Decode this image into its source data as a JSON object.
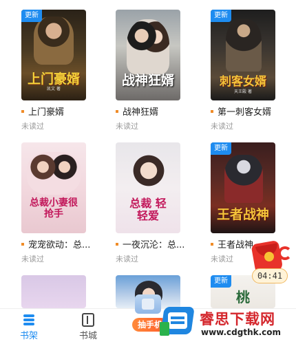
{
  "books": [
    {
      "title": "上门豪婿",
      "status": "未读过",
      "badge": "更新",
      "cover_title": "上门豪婿",
      "cover_author": "凯文 著",
      "cover_color": "#f4d23a"
    },
    {
      "title": "战神狂婿",
      "status": "未读过",
      "badge": "",
      "cover_title": "战神狂婿",
      "cover_author": "",
      "cover_color": "#ffffff"
    },
    {
      "title": "第一刺客女婿",
      "status": "未读过",
      "badge": "更新",
      "cover_title": "刺客女婿",
      "cover_author": "天王殿 著",
      "cover_color": "#f4c43a"
    },
    {
      "title": "宠宠欲动：总...",
      "status": "未读过",
      "badge": "",
      "cover_title": "总裁小妻很抢手",
      "cover_author": "",
      "cover_color": "#c2185b"
    },
    {
      "title": "一夜沉沦：总...",
      "status": "未读过",
      "badge": "",
      "cover_title": "总裁 轻轻爱",
      "cover_author": "",
      "cover_color": "#c2185b"
    },
    {
      "title": "王者战神",
      "status": "未读过",
      "badge": "更新",
      "cover_title": "王者战神",
      "cover_author": "",
      "cover_color": "#f4c43a"
    },
    {
      "title": "",
      "status": "",
      "badge": "",
      "cover_title": "",
      "cover_author": "",
      "cover_color": ""
    },
    {
      "title": "",
      "status": "",
      "badge": "",
      "cover_title": "",
      "cover_author": "",
      "cover_color": ""
    },
    {
      "title": "",
      "status": "",
      "badge": "更新",
      "cover_title": "桃",
      "cover_author": "",
      "cover_color": "#2a6a3a"
    }
  ],
  "timer": {
    "time": "04:41"
  },
  "nav": {
    "shelf": "书架",
    "store": "书城",
    "lottery": "抽手机",
    "partial": "?"
  },
  "watermark": {
    "name": "睿思下载网",
    "url": "www.cdgthk.com"
  },
  "colors": {
    "accent": "#1e8cf0",
    "badge": "#1e8cf0",
    "dot": "#f08c28",
    "lottery_btn": "#ff6a2a"
  }
}
